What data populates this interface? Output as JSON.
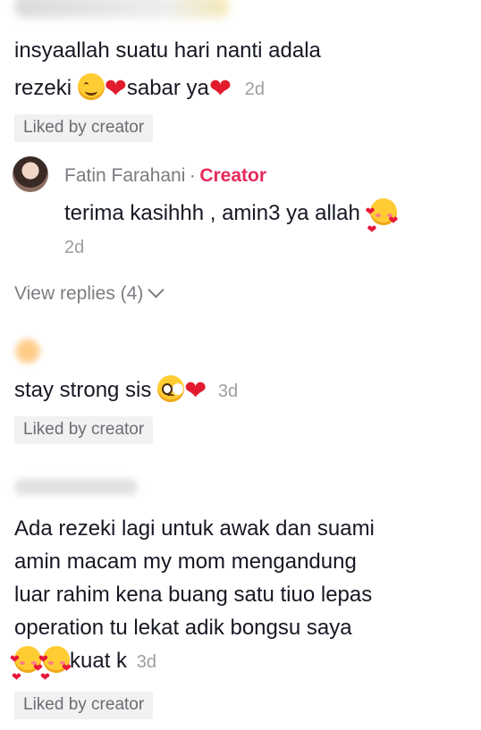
{
  "comment1": {
    "line1": "insyaallah suatu hari nanti adala",
    "line2": "rezeki",
    "line2b": "sabar ya",
    "time": "2d",
    "liked": "Liked by creator",
    "emojis": [
      "smiling-face-emoji",
      "red-heart-emoji",
      "red-heart-emoji"
    ]
  },
  "reply1": {
    "author": "Fatin Farahani",
    "separator": "·",
    "badge": "Creator",
    "text": "terima kasihhh , amin3 ya allah",
    "time": "2d",
    "emojis": [
      "smiling-face-with-hearts-emoji"
    ]
  },
  "view_replies": "View replies (4)",
  "comment2": {
    "text": "stay strong sis",
    "time": "3d",
    "liked": "Liked by creator",
    "emojis": [
      "pleading-face-emoji",
      "red-heart-emoji"
    ]
  },
  "comment3": {
    "lines": [
      "Ada rezeki lagi untuk awak dan suami",
      "amin macam my mom mengandung",
      "luar rahim kena buang satu tiuo lepas",
      "operation tu lekat adik bongsu saya"
    ],
    "last": "kuat k",
    "time": "3d",
    "liked": "Liked by creator",
    "emojis": [
      "smiling-face-with-hearts-emoji",
      "smiling-face-with-hearts-emoji"
    ]
  },
  "colors": {
    "text": "#161823",
    "muted": "#9e9e9e",
    "creator_badge": "#e62a5a",
    "heart": "#e21b2d",
    "liked_bg": "#f1f1f2"
  }
}
